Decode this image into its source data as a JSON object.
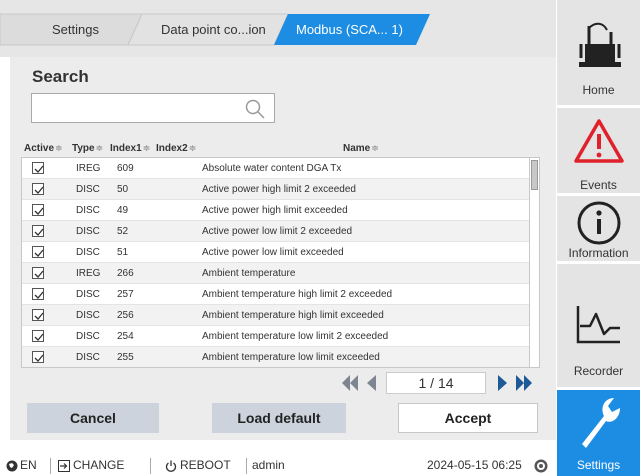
{
  "breadcrumbs": [
    "Settings",
    "Data point co...ion",
    "Modbus (SCA... 1)"
  ],
  "search": {
    "title": "Search",
    "value": "",
    "placeholder": ""
  },
  "table": {
    "headers": {
      "active": "Active",
      "type": "Type",
      "index1": "Index1",
      "index2": "Index2",
      "name": "Name"
    },
    "rows": [
      {
        "type": "IREG",
        "index1": "609",
        "index2": "",
        "name": "Absolute water content DGA Tx"
      },
      {
        "type": "DISC",
        "index1": "50",
        "index2": "",
        "name": "Active power high limit 2 exceeded"
      },
      {
        "type": "DISC",
        "index1": "49",
        "index2": "",
        "name": "Active power high limit exceeded"
      },
      {
        "type": "DISC",
        "index1": "52",
        "index2": "",
        "name": "Active power low limit 2 exceeded"
      },
      {
        "type": "DISC",
        "index1": "51",
        "index2": "",
        "name": "Active power low limit exceeded"
      },
      {
        "type": "IREG",
        "index1": "266",
        "index2": "",
        "name": "Ambient temperature"
      },
      {
        "type": "DISC",
        "index1": "257",
        "index2": "",
        "name": "Ambient temperature high limit 2 exceeded"
      },
      {
        "type": "DISC",
        "index1": "256",
        "index2": "",
        "name": "Ambient temperature high limit exceeded"
      },
      {
        "type": "DISC",
        "index1": "254",
        "index2": "",
        "name": "Ambient temperature low limit 2 exceeded"
      },
      {
        "type": "DISC",
        "index1": "255",
        "index2": "",
        "name": "Ambient temperature low limit exceeded"
      }
    ]
  },
  "pagination": {
    "display": "1 / 14"
  },
  "buttons": {
    "cancel": "Cancel",
    "load_default": "Load default",
    "accept": "Accept"
  },
  "status": {
    "language": "EN",
    "change": "CHANGE",
    "reboot": "REBOOT",
    "user": "admin",
    "datetime": "2024-05-15 06:25"
  },
  "nav": [
    "Home",
    "Events",
    "Information",
    "Recorder",
    "Settings"
  ],
  "colors": {
    "accent": "#1d8de3",
    "alert": "#e0202a",
    "button_grey": "#cdd3dc"
  },
  "icons": [
    "search-icon",
    "checkbox-checked-icon",
    "first-page-icon",
    "prev-page-icon",
    "next-page-icon",
    "last-page-icon",
    "language-icon",
    "change-icon",
    "power-icon",
    "user-status-icon",
    "transformer-icon",
    "warning-icon",
    "info-icon",
    "recorder-icon",
    "wrench-icon"
  ]
}
